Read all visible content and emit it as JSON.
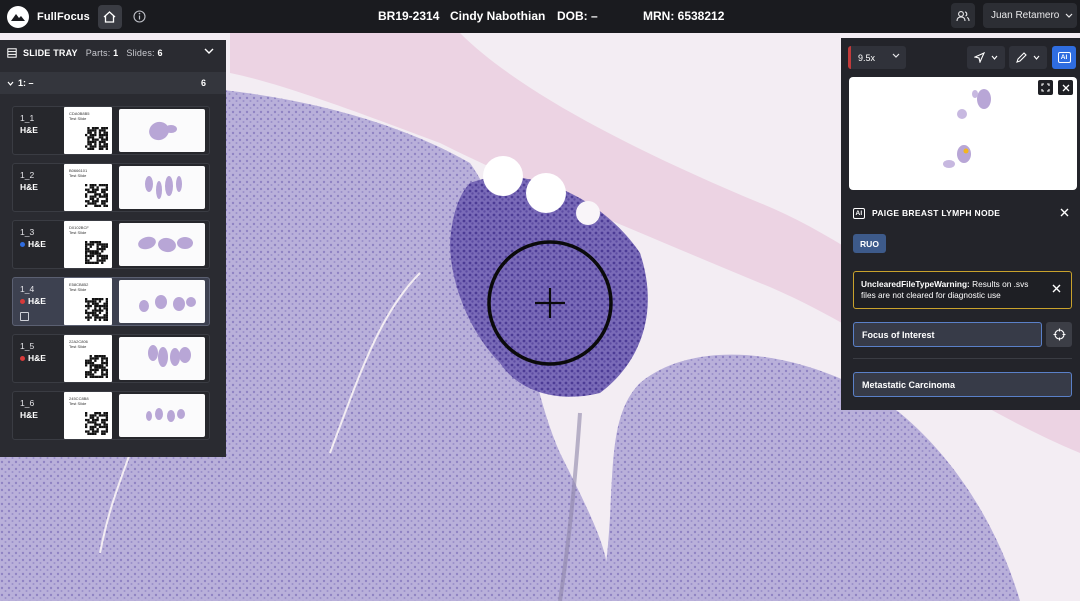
{
  "app": {
    "name": "FullFocus"
  },
  "header": {
    "case_id": "BR19-2314",
    "patient_name": "Cindy Nabothian",
    "dob": "DOB: –",
    "mrn": "MRN: 6538212",
    "user_name": "Juan Retamero"
  },
  "slide_tray": {
    "title": "SLIDE TRAY",
    "parts_label": "Parts:",
    "parts_count": "1",
    "slides_label": "Slides:",
    "slides_count": "6",
    "part": {
      "label": "1: –",
      "count": "6"
    },
    "slides": [
      {
        "id": "1_1",
        "stain": "H&E",
        "flag": "none",
        "code": "CDA0B8B5",
        "desc": "Test Slide",
        "selected": false
      },
      {
        "id": "1_2",
        "stain": "H&E",
        "flag": "none",
        "code": "B0666101",
        "desc": "Test Slide",
        "selected": false
      },
      {
        "id": "1_3",
        "stain": "H&E",
        "flag": "blue",
        "code": "D0102BCF",
        "desc": "Test Slide",
        "selected": false
      },
      {
        "id": "1_4",
        "stain": "H&E",
        "flag": "red",
        "code": "E58CB852",
        "desc": "Test Slide",
        "selected": true
      },
      {
        "id": "1_5",
        "stain": "H&E",
        "flag": "red",
        "code": "22A2C806",
        "desc": "Test Slide",
        "selected": false
      },
      {
        "id": "1_6",
        "stain": "H&E",
        "flag": "none",
        "code": "245CC8B8",
        "desc": "Test Slide",
        "selected": false
      }
    ]
  },
  "viewer_panel": {
    "zoom": "9.5x",
    "ai_label": "AI"
  },
  "ai_panel": {
    "ai_badge": "AI",
    "title": "PAIGE BREAST LYMPH NODE",
    "ruo": "RUO",
    "warning_title": "UnclearedFileTypeWarning:",
    "warning_text": "Results on .svs files are not cleared for diagnostic use",
    "focus_label": "Focus of Interest",
    "result": "Metastatic Carcinoma"
  },
  "colors": {
    "topbar": "#1a1b1f",
    "panel": "#23242a",
    "accent": "#2f6de0",
    "warning": "#c9a22c",
    "flag_blue": "#2f6de0",
    "flag_red": "#d83a3a",
    "tissue": "#b8a6d6"
  }
}
